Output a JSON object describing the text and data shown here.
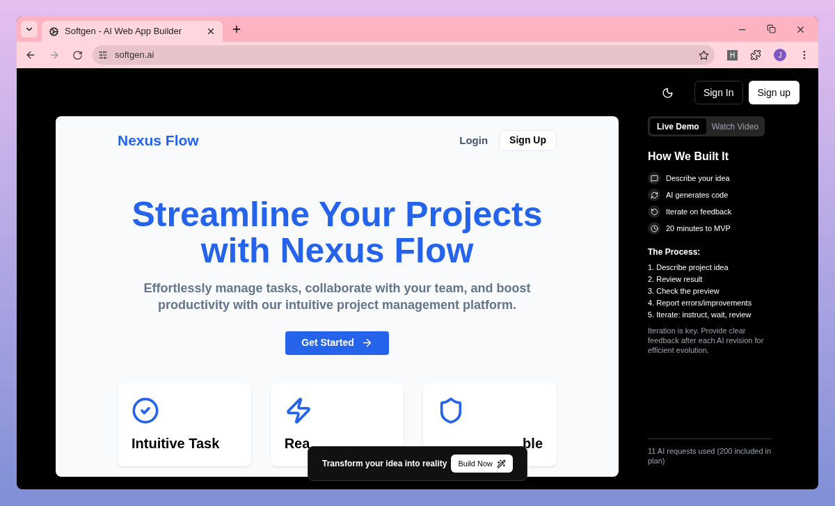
{
  "browser": {
    "tab_title": "Softgen - AI Web App Builder",
    "url": "softgen.ai",
    "extension_label": "H",
    "profile_initial": "J"
  },
  "site_header": {
    "buttons": [
      {
        "label": "Sign In",
        "kind": "outline"
      },
      {
        "label": "Sign up",
        "kind": "solid"
      }
    ]
  },
  "preview": {
    "brand": "Nexus Flow",
    "nav": [
      {
        "label": "Login",
        "kind": "link"
      },
      {
        "label": "Sign Up",
        "kind": "button"
      }
    ],
    "headline": "Streamline Your Projects with Nexus Flow",
    "subheadline": "Effortlessly manage tasks, collaborate with your team, and boost productivity with our intuitive project management platform.",
    "cta": "Get Started",
    "cards": [
      {
        "title": "Intuitive Task",
        "kind": "check"
      },
      {
        "title": "Rea",
        "kind": "bolt"
      },
      {
        "title": "ble",
        "kind": "shield"
      }
    ]
  },
  "toast": {
    "text": "Transform your idea into reality",
    "button": "Build Now"
  },
  "sidebar": {
    "tabs": [
      {
        "label": "Live Demo",
        "selected": true
      },
      {
        "label": "Watch Video",
        "selected": false
      }
    ],
    "title": "How We Built It",
    "steps": [
      {
        "text": "Describe your idea",
        "kind": "message"
      },
      {
        "text": "AI generates code",
        "kind": "refresh"
      },
      {
        "text": "Iterate on feedback",
        "kind": "rotate"
      },
      {
        "text": "20 minutes to MVP",
        "kind": "clock"
      }
    ],
    "process_title": "The Process:",
    "process_items": [
      "1. Describe project idea",
      "2. Review result",
      "3. Check the preview",
      "4. Report errors/improvements",
      "5. Iterate: instruct, wait, review"
    ],
    "note": "Iteration is key. Provide clear feedback after each AI revision for efficient evolution.",
    "usage": "11 AI requests used (200 included in plan)"
  }
}
